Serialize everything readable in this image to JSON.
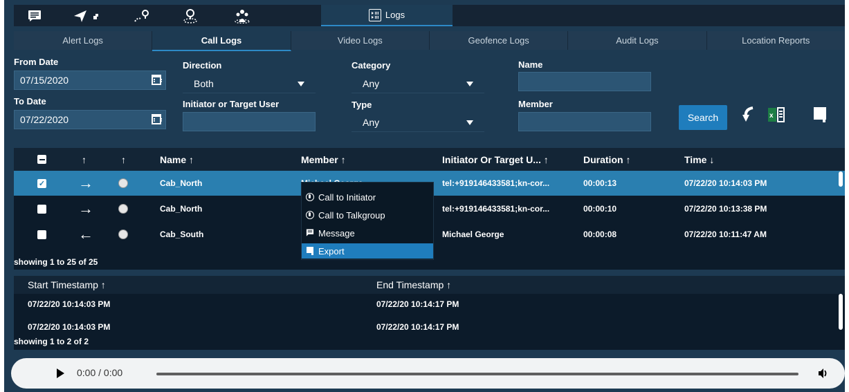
{
  "top_tabs": {
    "active_label": "Logs",
    "icons": [
      "chat-icon",
      "send-icon",
      "map-icon",
      "location-pin-icon",
      "group-icon",
      "logs-icon"
    ]
  },
  "sub_tabs": [
    "Alert Logs",
    "Call Logs",
    "Video Logs",
    "Geofence Logs",
    "Audit Logs",
    "Location Reports"
  ],
  "filters": {
    "from_date_label": "From Date",
    "from_date": "07/15/2020",
    "to_date_label": "To Date",
    "to_date": "07/22/2020",
    "direction_label": "Direction",
    "direction_value": "Both",
    "initiator_label": "Initiator or Target User",
    "initiator_value": "",
    "category_label": "Category",
    "category_value": "Any",
    "type_label": "Type",
    "type_value": "Any",
    "name_label": "Name",
    "name_value": "",
    "member_label": "Member",
    "member_value": "",
    "search_label": "Search"
  },
  "main_table": {
    "headers": {
      "dir": "↑",
      "type": "↑",
      "name": "Name ↑",
      "member": "Member ↑",
      "initiator": "Initiator Or Target U... ↑",
      "duration": "Duration ↑",
      "time": "Time ↓"
    },
    "rows": [
      {
        "checked": true,
        "dir": "→",
        "name": "Cab_North",
        "member": "Michael George",
        "initiator": "tel:+919146433581;kn-cor...",
        "duration": "00:00:13",
        "time": "07/22/20 10:14:03 PM"
      },
      {
        "checked": false,
        "dir": "→",
        "name": "Cab_North",
        "member": "",
        "initiator": "tel:+919146433581;kn-cor...",
        "duration": "00:00:10",
        "time": "07/22/20 10:13:38 PM"
      },
      {
        "checked": false,
        "dir": "←",
        "name": "Cab_South",
        "member": "",
        "initiator": "Michael George",
        "duration": "00:00:08",
        "time": "07/22/20 10:11:47 AM"
      }
    ],
    "showing": "showing 1 to 25 of 25"
  },
  "context_menu": {
    "call_initiator": "Call to Initiator",
    "call_talkgroup": "Call to Talkgroup",
    "message": "Message",
    "export": "Export"
  },
  "sub_table": {
    "start_header": "Start Timestamp ↑",
    "end_header": "End Timestamp ↑",
    "rows": [
      {
        "start": "07/22/20 10:14:03 PM",
        "end": "07/22/20 10:14:17 PM"
      },
      {
        "start": "07/22/20 10:14:03 PM",
        "end": "07/22/20 10:14:17 PM"
      }
    ],
    "showing": "showing 1 to 2 of 2"
  },
  "player": {
    "time": "0:00 / 0:00"
  }
}
